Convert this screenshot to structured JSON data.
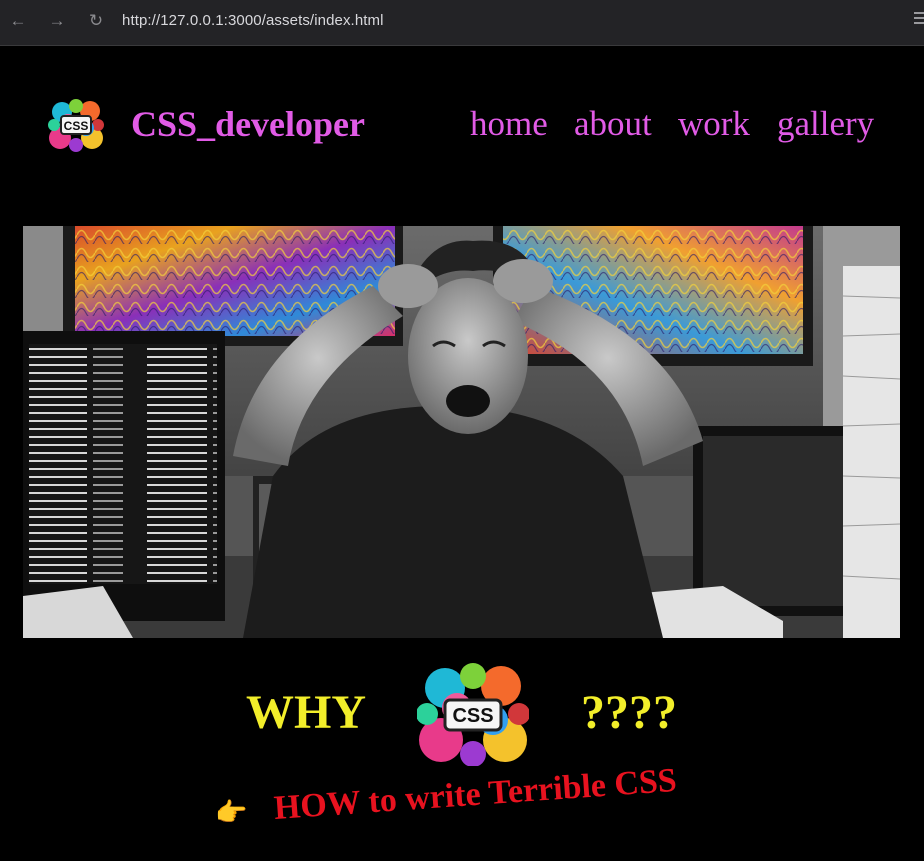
{
  "browser": {
    "back_icon": "←",
    "forward_icon": "→",
    "reload_icon": "↻",
    "url": "http://127.0.0.1:3000/assets/index.html"
  },
  "header": {
    "brand": "CSS_developer",
    "logo_label": "CSS",
    "nav": [
      "home",
      "about",
      "work",
      "gallery"
    ]
  },
  "hero": {
    "description_icon": "stressed-developer-photo"
  },
  "why_row": {
    "left": "WHY",
    "logo_label": "CSS",
    "right": "????"
  },
  "how_link": {
    "pointer_icon": "👉",
    "label": "HOW to write Terrible CSS"
  },
  "colors": {
    "accent_pink": "#e15be6",
    "yellow": "#f2ee2a",
    "red": "#e8121f",
    "background": "#000000"
  }
}
